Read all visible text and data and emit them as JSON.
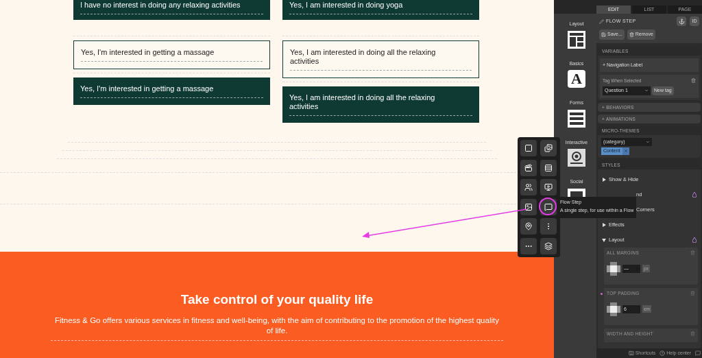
{
  "canvas": {
    "columns": [
      {
        "cards": [
          {
            "text": "I have no interest in doing any relaxing activities",
            "kind": "filled"
          },
          {
            "text": "Yes, I'm interested in getting a massage",
            "kind": "outlined"
          },
          {
            "text": "Yes, I'm interested in getting a massage",
            "kind": "filled"
          }
        ]
      },
      {
        "cards": [
          {
            "text": "Yes, I am interested in doing yoga",
            "kind": "filled"
          },
          {
            "text": "Yes, I am interested in doing all the relaxing activities",
            "kind": "outlined"
          },
          {
            "text": "Yes, I am interested in doing all the relaxing activities",
            "kind": "filled"
          }
        ]
      }
    ],
    "banner": {
      "heading": "Take control of your quality life",
      "text": "Fitness & Go offers various services in fitness and well-being, with the aim of contributing to the promotion of the highest quality of life."
    }
  },
  "categories": [
    {
      "label": "Layout",
      "kind": "layout"
    },
    {
      "label": "Basics",
      "kind": "basics",
      "glyph": "A"
    },
    {
      "label": "Forms",
      "kind": "forms"
    },
    {
      "label": "Interactive",
      "kind": "interactive"
    },
    {
      "label": "Social",
      "kind": "social"
    }
  ],
  "tabs": [
    {
      "label": "EDIT",
      "selected": true
    },
    {
      "label": "LIST",
      "selected": false
    },
    {
      "label": "PAGE",
      "selected": false
    }
  ],
  "header": {
    "title": "FLOW STEP",
    "id_button": "ID",
    "save": "Save...",
    "remove": "Remove"
  },
  "variables": {
    "title": "VARIABLES",
    "navigation": "+ Navigation Label",
    "tag_label": "Tag When Selected",
    "tag_value": "Question 1",
    "new_tag": "New tag"
  },
  "collapsed_sections": [
    "+ BEHAVIORS",
    "+ ANIMATIONS"
  ],
  "micro_themes": {
    "title": "MICRO-THEMES",
    "category": "(category)",
    "tag": "Content"
  },
  "styles": {
    "title": "STYLES",
    "rows": [
      {
        "label": "Show & Hide",
        "kind": "toggle",
        "expanded": false,
        "marked": false
      },
      {
        "label": "nd",
        "kind": "partial",
        "marked": true
      },
      {
        "label": "Corners",
        "kind": "partial",
        "marked": false
      },
      {
        "label": "Effects",
        "kind": "toggle",
        "expanded": false,
        "marked": false
      },
      {
        "label": "Layout",
        "kind": "toggle",
        "expanded": true,
        "marked": true
      }
    ],
    "groups": [
      {
        "title": "ALL MARGINS",
        "value": "—",
        "unit": "px",
        "modified": false
      },
      {
        "title": "TOP PADDING",
        "value": "6",
        "unit": "em",
        "modified": true
      },
      {
        "title": "WIDTH AND HEIGHT",
        "modified": false
      }
    ]
  },
  "footer": {
    "shortcuts": "Shortcuts",
    "help": "Help center"
  },
  "tooltip": {
    "title": "Flow Step",
    "text": "A single step, for use within a Flow"
  }
}
